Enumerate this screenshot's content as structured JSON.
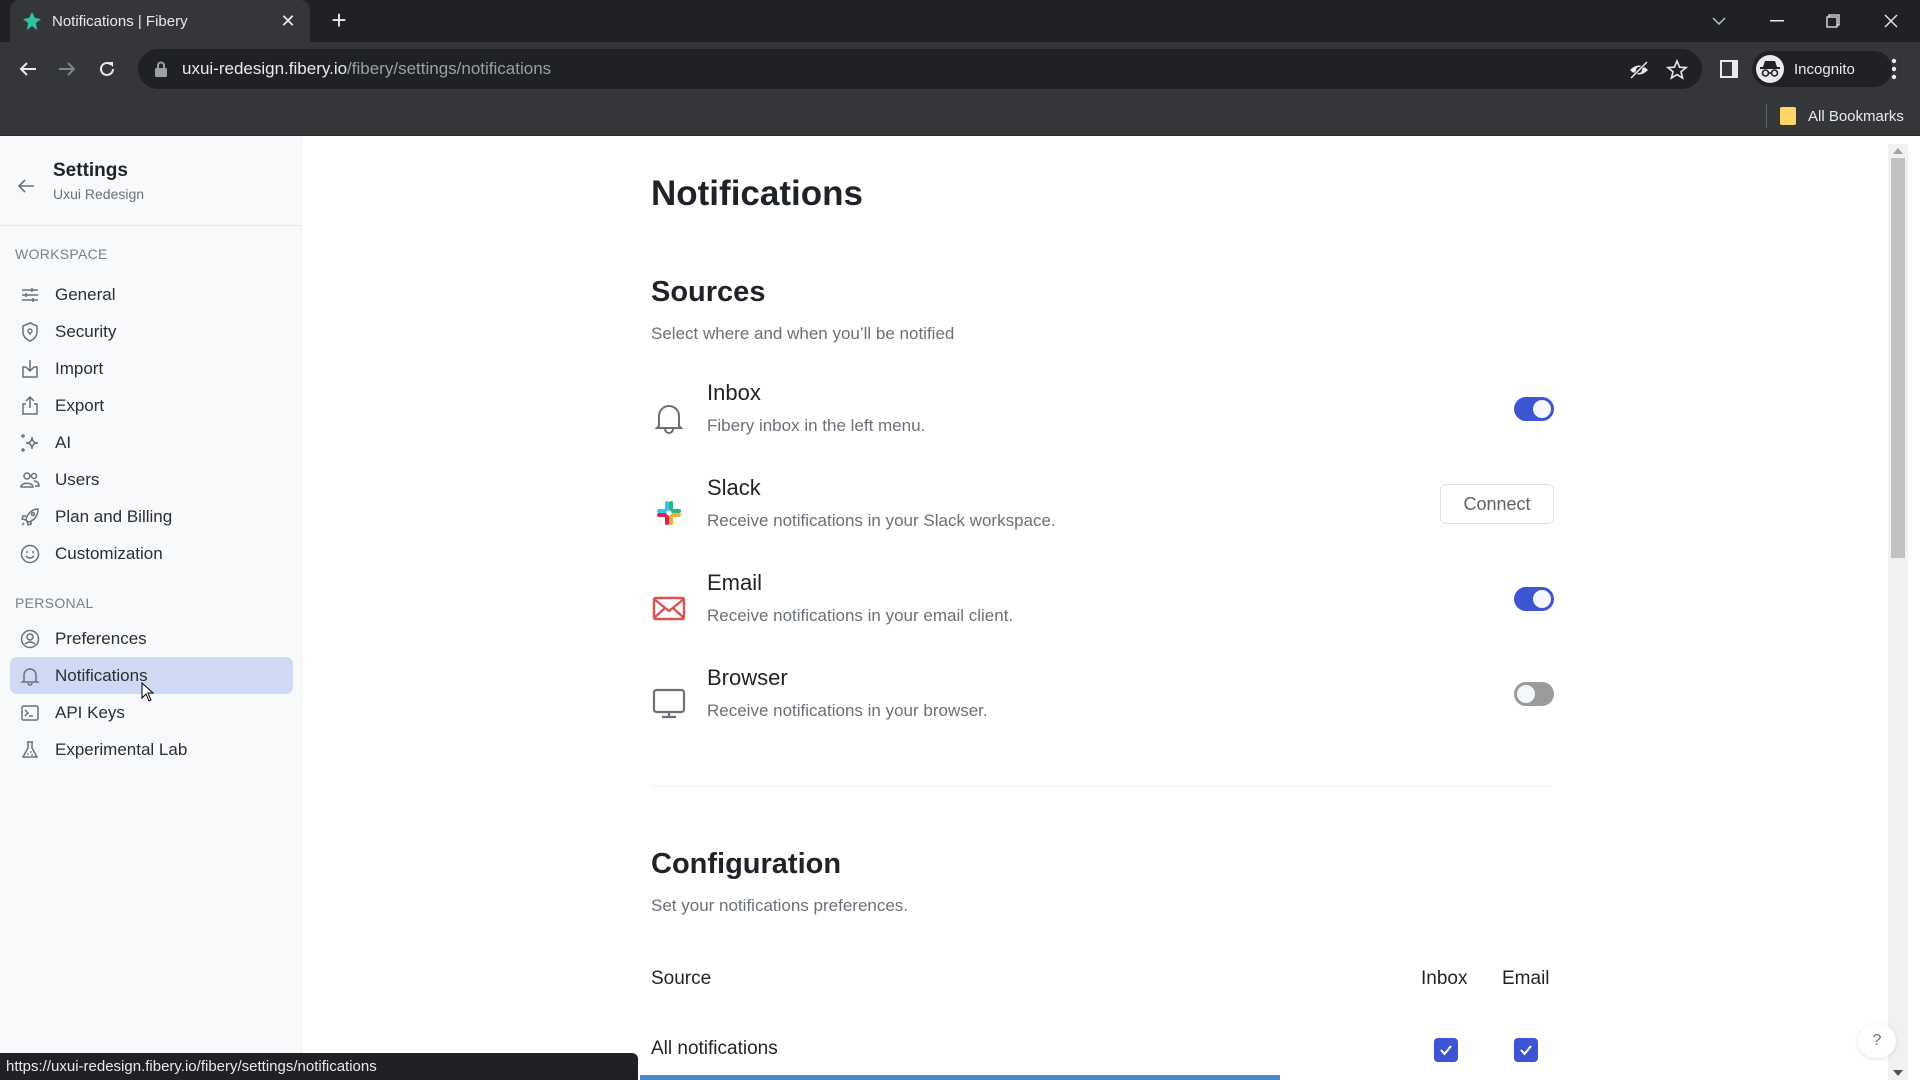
{
  "browser": {
    "tab_title": "Notifications | Fibery",
    "new_tab_label": "+",
    "url_host": "uxui-redesign.fibery.io",
    "url_path": "/fibery/settings/notifications",
    "profile_label": "Incognito",
    "bookmarks_label": "All Bookmarks",
    "status_url": "https://uxui-redesign.fibery.io/fibery/settings/notifications"
  },
  "sidebar": {
    "title": "Settings",
    "subtitle": "Uxui Redesign",
    "sections": [
      {
        "label": "WORKSPACE",
        "items": [
          {
            "label": "General",
            "icon": "sliders-icon"
          },
          {
            "label": "Security",
            "icon": "shield-icon"
          },
          {
            "label": "Import",
            "icon": "import-icon"
          },
          {
            "label": "Export",
            "icon": "export-icon"
          },
          {
            "label": "AI",
            "icon": "sparkles-icon"
          },
          {
            "label": "Users",
            "icon": "users-icon"
          },
          {
            "label": "Plan and Billing",
            "icon": "rocket-icon"
          },
          {
            "label": "Customization",
            "icon": "smiley-icon"
          }
        ]
      },
      {
        "label": "PERSONAL",
        "items": [
          {
            "label": "Preferences",
            "icon": "user-circle-icon"
          },
          {
            "label": "Notifications",
            "icon": "bell-icon",
            "active": true
          },
          {
            "label": "API Keys",
            "icon": "terminal-icon"
          },
          {
            "label": "Experimental Lab",
            "icon": "flask-icon"
          }
        ]
      }
    ]
  },
  "main": {
    "title": "Notifications",
    "sources": {
      "heading": "Sources",
      "subtitle": "Select where and when you’ll be notified",
      "items": [
        {
          "name": "Inbox",
          "desc": "Fibery inbox in the left menu.",
          "icon": "bell-icon",
          "control": "toggle",
          "enabled": true
        },
        {
          "name": "Slack",
          "desc": "Receive notifications in your Slack workspace.",
          "icon": "slack-icon",
          "control": "button",
          "button_label": "Connect"
        },
        {
          "name": "Email",
          "desc": "Receive notifications in your email client.",
          "icon": "mail-icon",
          "control": "toggle",
          "enabled": true
        },
        {
          "name": "Browser",
          "desc": "Receive notifications in your browser.",
          "icon": "monitor-icon",
          "control": "toggle",
          "enabled": false
        }
      ]
    },
    "configuration": {
      "heading": "Configuration",
      "subtitle": "Set your notifications preferences.",
      "columns": [
        "Source",
        "Inbox",
        "Email"
      ],
      "rows": [
        {
          "label": "All notifications",
          "inbox": true,
          "email": true
        }
      ]
    },
    "help_label": "?"
  },
  "colors": {
    "accent": "#3d55d3",
    "active_nav_bg": "#cfd9f3",
    "toggle_off": "#9b9b9b",
    "email_icon": "#d9534f"
  }
}
